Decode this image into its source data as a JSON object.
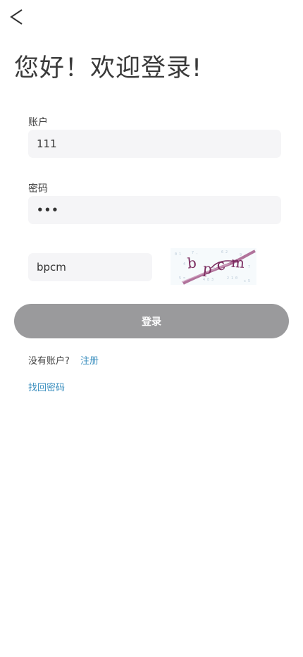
{
  "header": {
    "back_icon": "chevron-left-icon"
  },
  "page": {
    "title": "您好！欢迎登录!"
  },
  "form": {
    "account_label": "账户",
    "account_value": "111",
    "password_label": "密码",
    "password_value": "•••",
    "captcha_value": "bpcm",
    "captcha_image_text": "bpcm",
    "login_label": "登录"
  },
  "footer": {
    "no_account_text": "没有账户?",
    "register_label": "注册",
    "recover_label": "找回密码"
  },
  "colors": {
    "background": "#ffffff",
    "input_bg": "#f5f5f7",
    "button_bg": "#9a9a9c",
    "link": "#3b8fbf"
  }
}
